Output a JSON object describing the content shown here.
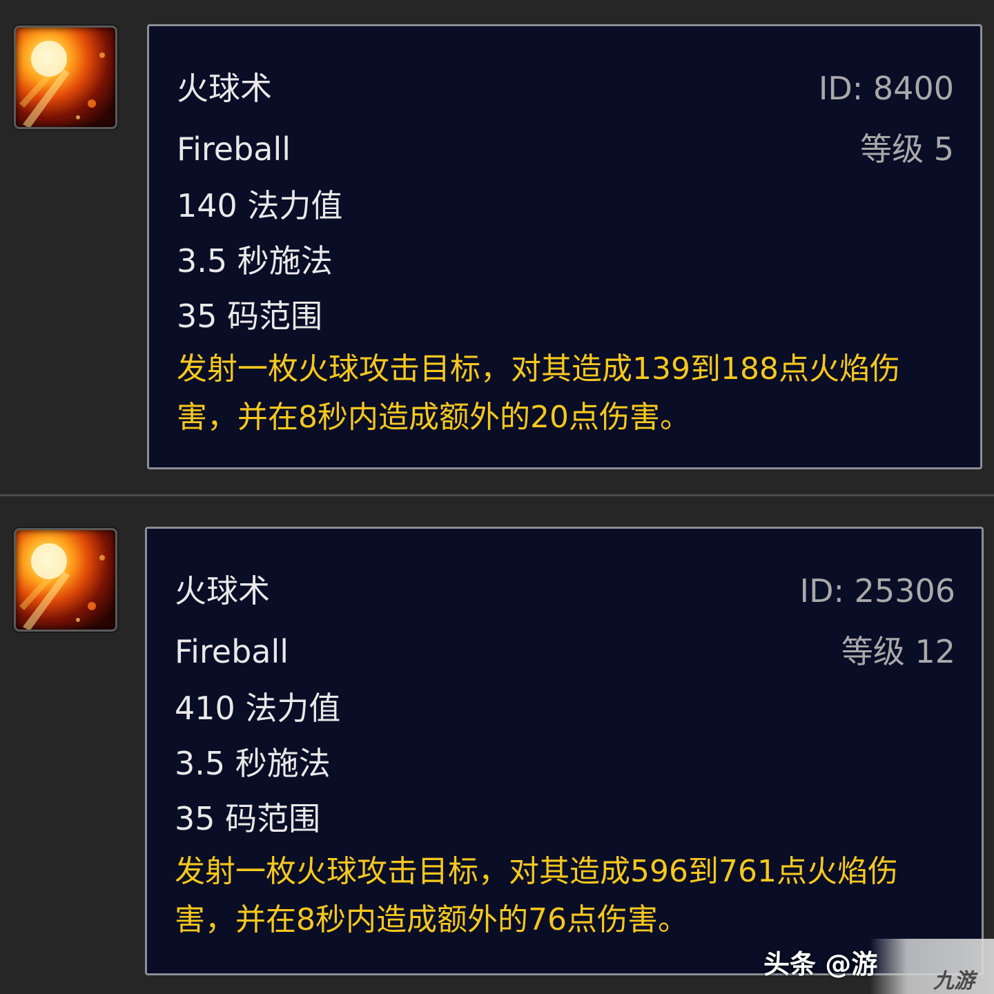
{
  "spells": [
    {
      "name_cn": "火球术",
      "name_en": "Fireball",
      "id_label": "ID: 8400",
      "rank_label": "等级 5",
      "mana": "140 法力值",
      "cast": "3.5 秒施法",
      "range": "35 码范围",
      "description": "发射一枚火球攻击目标，对其造成139到188点火焰伤害，并在8秒内造成额外的20点伤害。",
      "icon": "fireball-icon"
    },
    {
      "name_cn": "火球术",
      "name_en": "Fireball",
      "id_label": "ID: 25306",
      "rank_label": "等级 12",
      "mana": "410 法力值",
      "cast": "3.5 秒施法",
      "range": "35 码范围",
      "description": "发射一枚火球攻击目标，对其造成596到761点火焰伤害，并在8秒内造成额外的76点伤害。",
      "icon": "fireball-icon"
    }
  ],
  "watermark": {
    "text": "头条 @游",
    "logo": "九游"
  },
  "colors": {
    "background": "#262626",
    "tooltip_bg": "#090d26",
    "tooltip_border": "#8c8f96",
    "text_white": "#e9e9e9",
    "text_grey": "#a9a9a9",
    "text_gold": "#f7c81e"
  }
}
